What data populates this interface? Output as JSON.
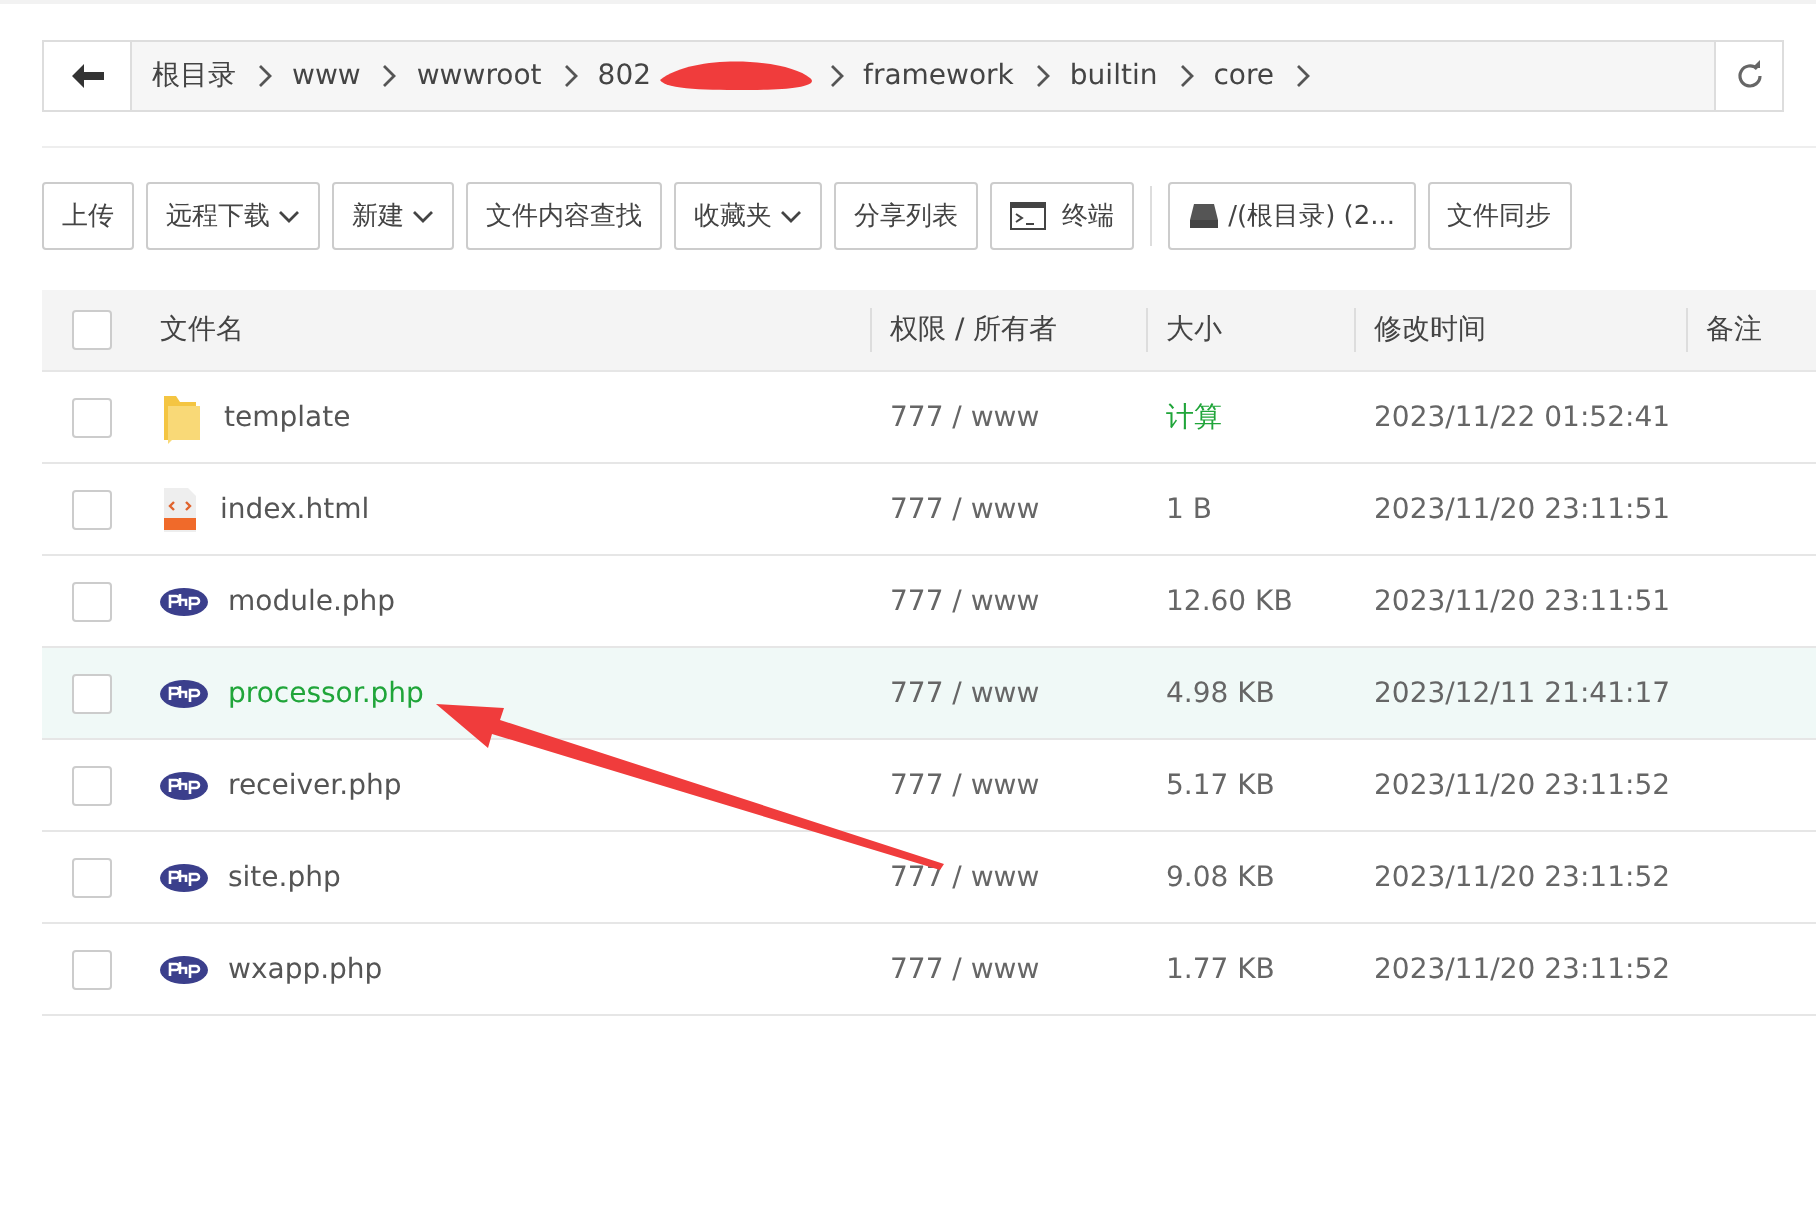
{
  "breadcrumb": {
    "items": [
      "根目录",
      "www",
      "wwwroot",
      "802",
      "framework",
      "builtin",
      "core"
    ]
  },
  "toolbar": [
    {
      "label": "上传",
      "kind": "plain"
    },
    {
      "label": "远程下载",
      "kind": "dropdown"
    },
    {
      "label": "新建",
      "kind": "dropdown"
    },
    {
      "label": "文件内容查找",
      "kind": "plain"
    },
    {
      "label": "收藏夹",
      "kind": "dropdown"
    },
    {
      "label": "分享列表",
      "kind": "plain"
    },
    {
      "label": "终端",
      "kind": "terminal"
    },
    {
      "label": "/(根目录) (2...",
      "kind": "disk"
    },
    {
      "label": "文件同步",
      "kind": "plain"
    }
  ],
  "table": {
    "all_checked": false,
    "columns": [
      "文件名",
      "权限 / 所有者",
      "大小",
      "修改时间",
      "备注"
    ],
    "rows": [
      {
        "kind": "folder",
        "name": "template",
        "permission": "777 / www",
        "size": "计算",
        "modified": "2023/11/22 01:52:41",
        "checked": false,
        "selected": false
      },
      {
        "kind": "html",
        "name": "index.html",
        "permission": "777 / www",
        "size": "1 B",
        "modified": "2023/11/20 23:11:51",
        "checked": false,
        "selected": false
      },
      {
        "kind": "php",
        "name": "module.php",
        "permission": "777 / www",
        "size": "12.60 KB",
        "modified": "2023/11/20 23:11:51",
        "checked": false,
        "selected": false
      },
      {
        "kind": "php",
        "name": "processor.php",
        "permission": "777 / www",
        "size": "4.98 KB",
        "modified": "2023/12/11 21:41:17",
        "checked": false,
        "selected": true
      },
      {
        "kind": "php",
        "name": "receiver.php",
        "permission": "777 / www",
        "size": "5.17 KB",
        "modified": "2023/11/20 23:11:52",
        "checked": false,
        "selected": false
      },
      {
        "kind": "php",
        "name": "site.php",
        "permission": "777 / www",
        "size": "9.08 KB",
        "modified": "2023/11/20 23:11:52",
        "checked": false,
        "selected": false
      },
      {
        "kind": "php",
        "name": "wxapp.php",
        "permission": "777 / www",
        "size": "1.77 KB",
        "modified": "2023/11/20 23:11:52",
        "checked": false,
        "selected": false
      }
    ]
  }
}
